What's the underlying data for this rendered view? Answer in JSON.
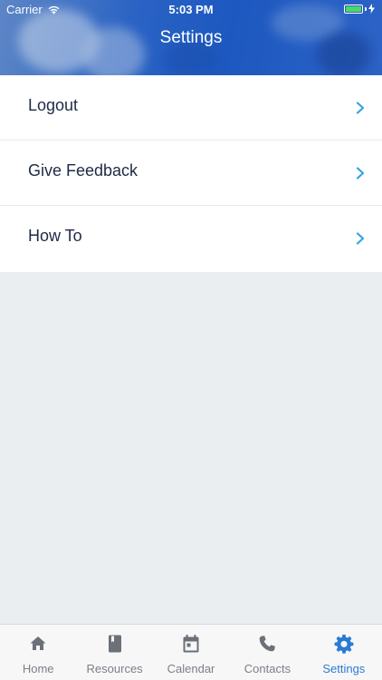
{
  "status_bar": {
    "carrier": "Carrier",
    "time": "5:03 PM",
    "battery_color": "#4cd964"
  },
  "header": {
    "title": "Settings"
  },
  "settings_items": [
    {
      "label": "Logout",
      "icon": "chevron-right-icon"
    },
    {
      "label": "Give Feedback",
      "icon": "chevron-right-icon"
    },
    {
      "label": "How To",
      "icon": "chevron-right-icon"
    }
  ],
  "tab_bar": {
    "active_color": "#2a7ad4",
    "inactive_color": "#7b8087",
    "tabs": [
      {
        "label": "Home",
        "icon": "home-icon",
        "active": false
      },
      {
        "label": "Resources",
        "icon": "book-icon",
        "active": false
      },
      {
        "label": "Calendar",
        "icon": "calendar-icon",
        "active": false
      },
      {
        "label": "Contacts",
        "icon": "phone-icon",
        "active": false
      },
      {
        "label": "Settings",
        "icon": "gear-icon",
        "active": true
      }
    ]
  },
  "colors": {
    "accent": "#2a7ad4",
    "chevron": "#34a3e0",
    "text": "#1f2a44",
    "background": "#ebeef0"
  }
}
